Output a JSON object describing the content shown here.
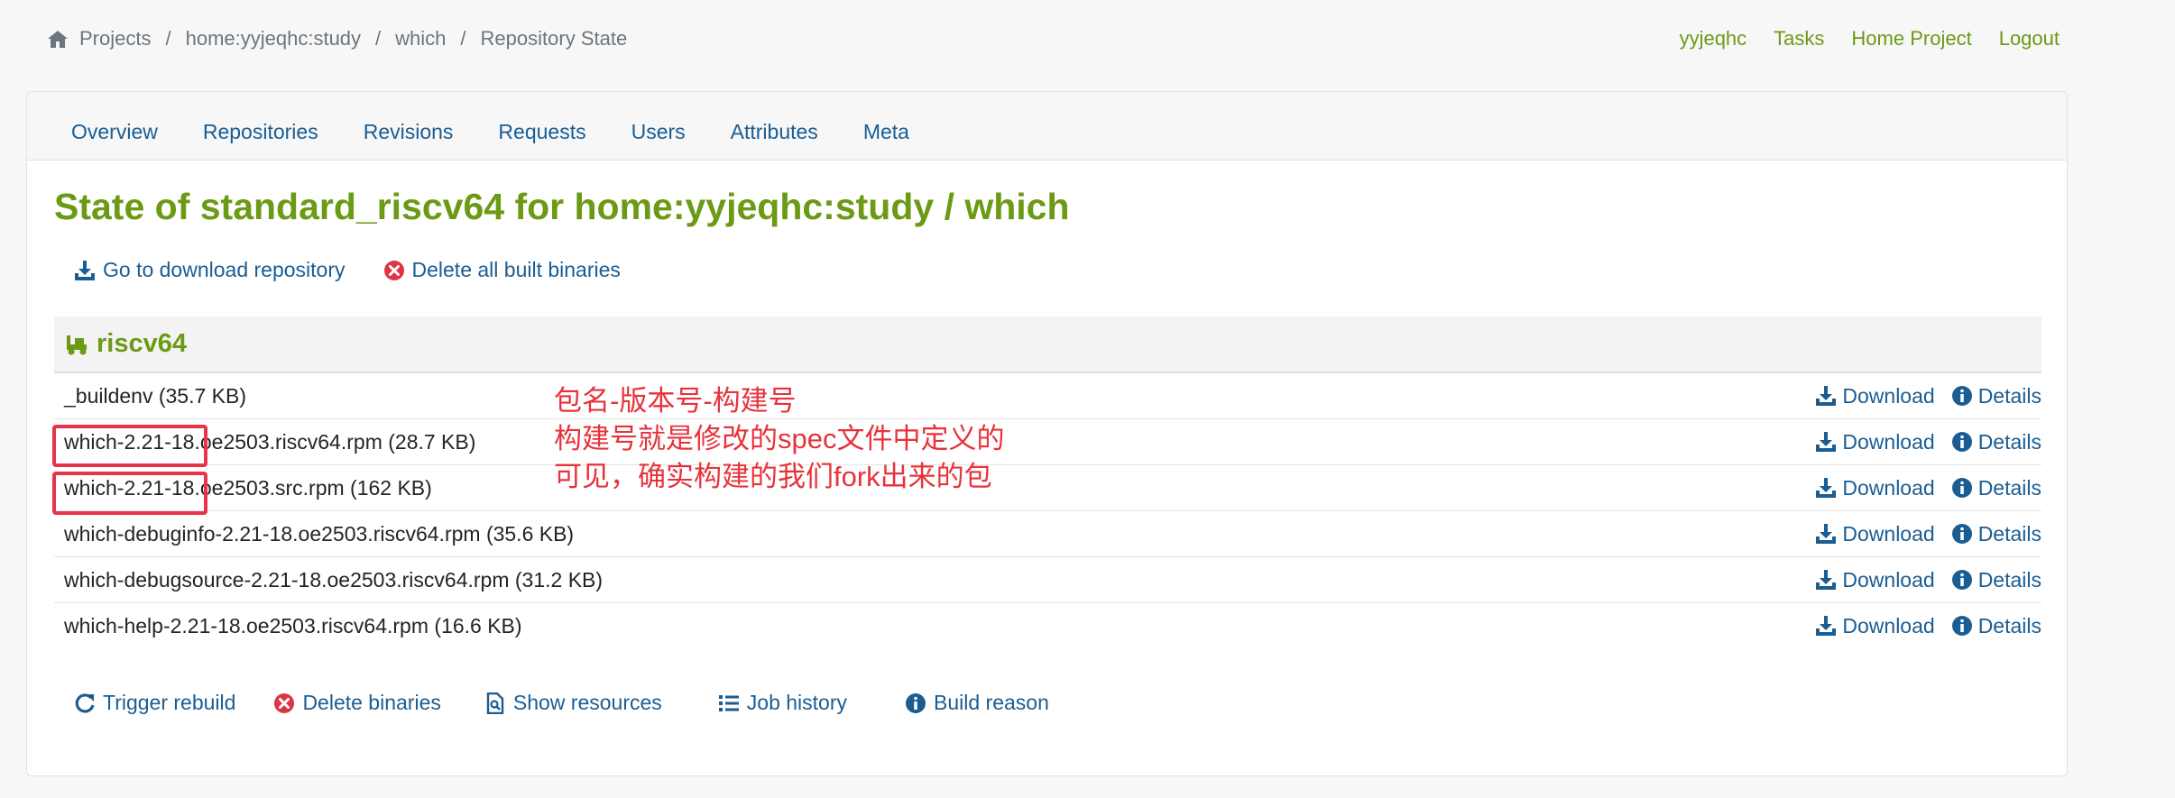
{
  "breadcrumb": {
    "items": [
      "Projects",
      "home:yyjeqhc:study",
      "which"
    ],
    "current": "Repository State",
    "separator": "/"
  },
  "user_nav": {
    "username": "yyjeqhc",
    "tasks": "Tasks",
    "home_project": "Home Project",
    "logout": "Logout"
  },
  "tabs": [
    "Overview",
    "Repositories",
    "Revisions",
    "Requests",
    "Users",
    "Attributes",
    "Meta"
  ],
  "page_title": "State of standard_riscv64 for home:yyjeqhc:study / which",
  "top_actions": {
    "download_repo": "Go to download repository",
    "delete_all": "Delete all built binaries"
  },
  "repository": {
    "name": "riscv64",
    "files": [
      {
        "name": "_buildenv (35.7 KB)"
      },
      {
        "name": "which-2.21-18.oe2503.riscv64.rpm (28.7 KB)"
      },
      {
        "name": "which-2.21-18.oe2503.src.rpm (162 KB)"
      },
      {
        "name": "which-debuginfo-2.21-18.oe2503.riscv64.rpm (35.6 KB)"
      },
      {
        "name": "which-debugsource-2.21-18.oe2503.riscv64.rpm (31.2 KB)"
      },
      {
        "name": "which-help-2.21-18.oe2503.riscv64.rpm (16.6 KB)"
      }
    ],
    "download_label": "Download",
    "details_label": "Details"
  },
  "bottom_actions": {
    "trigger_rebuild": "Trigger rebuild",
    "delete_binaries": "Delete binaries",
    "show_resources": "Show resources",
    "job_history": "Job history",
    "build_reason": "Build reason"
  },
  "annotation": {
    "lines": [
      "包名-版本号-构建号",
      "构建号就是修改的spec文件中定义的",
      "可见，确实构建的我们fork出来的包"
    ]
  },
  "colors": {
    "brand_green": "#6b9a14",
    "link_blue": "#1a5d93",
    "delete_red": "#dc3545",
    "annotation_red": "#e8323b"
  }
}
